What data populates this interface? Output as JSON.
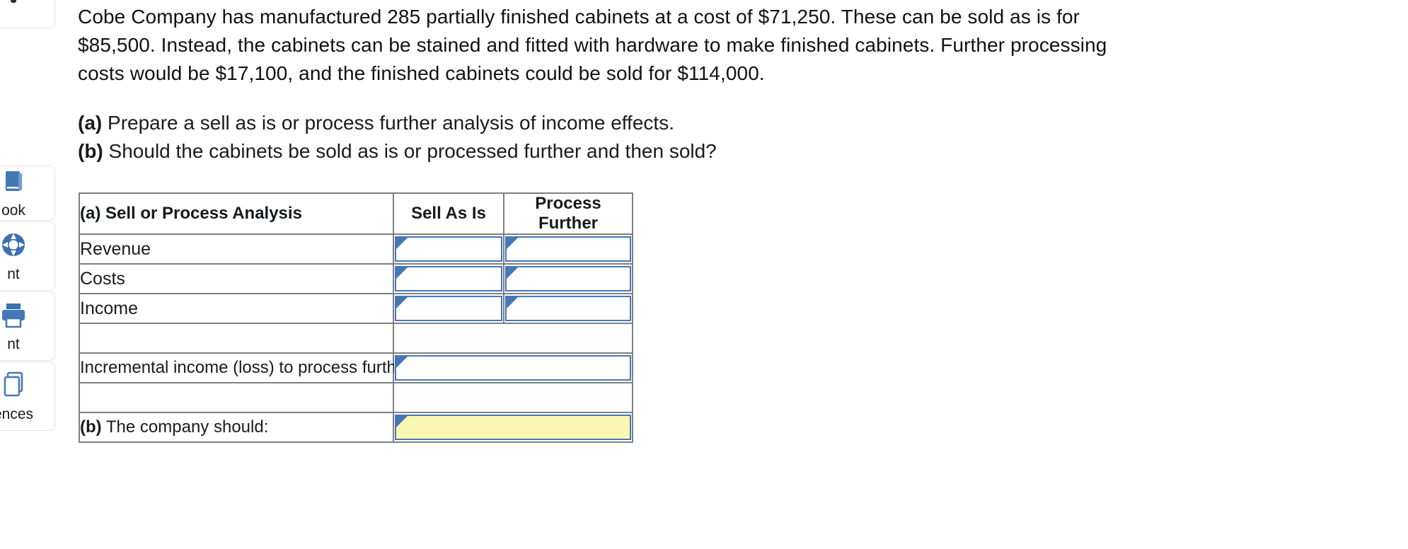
{
  "sidebar": {
    "items": [
      {
        "label": "",
        "icon": "pin-icon"
      },
      {
        "label": "ook",
        "icon": "ebook-icon"
      },
      {
        "label": "nt",
        "icon": "hint-icon"
      },
      {
        "label": "nt",
        "icon": "print-icon"
      },
      {
        "label": "ences",
        "icon": "references-icon"
      }
    ]
  },
  "question": {
    "body": "Cobe Company has manufactured 285 partially finished cabinets at a cost of $71,250. These can be sold as is for $85,500. Instead, the cabinets can be stained and fitted with hardware to make finished cabinets. Further processing costs would be $17,100, and the finished cabinets could be sold for $114,000.",
    "part_a_marker": "(a)",
    "part_a_text": " Prepare a sell as is or process further analysis of income effects.",
    "part_b_marker": "(b)",
    "part_b_text": " Should the cabinets be sold as is or processed further and then sold?"
  },
  "table": {
    "headers": {
      "analysis": "(a) Sell or Process Analysis",
      "sell_as_is": "Sell As Is",
      "process_further": "Process Further"
    },
    "rows": [
      {
        "label": "Revenue",
        "sell_as_is": "",
        "process_further": ""
      },
      {
        "label": "Costs",
        "sell_as_is": "",
        "process_further": ""
      },
      {
        "label": "Income",
        "sell_as_is": "",
        "process_further": ""
      }
    ],
    "incremental": {
      "label": "Incremental income (loss) to process further",
      "value": ""
    },
    "conclusion": {
      "marker": "(b)",
      "label": " The company should:",
      "value": ""
    }
  },
  "colors": {
    "header_blue": "#89ACDE",
    "input_border_blue": "#4577B5",
    "cell_border_gray": "#808080",
    "answer_yellow": "#FAF6B4",
    "icon_blue": "#3A6FB0"
  }
}
